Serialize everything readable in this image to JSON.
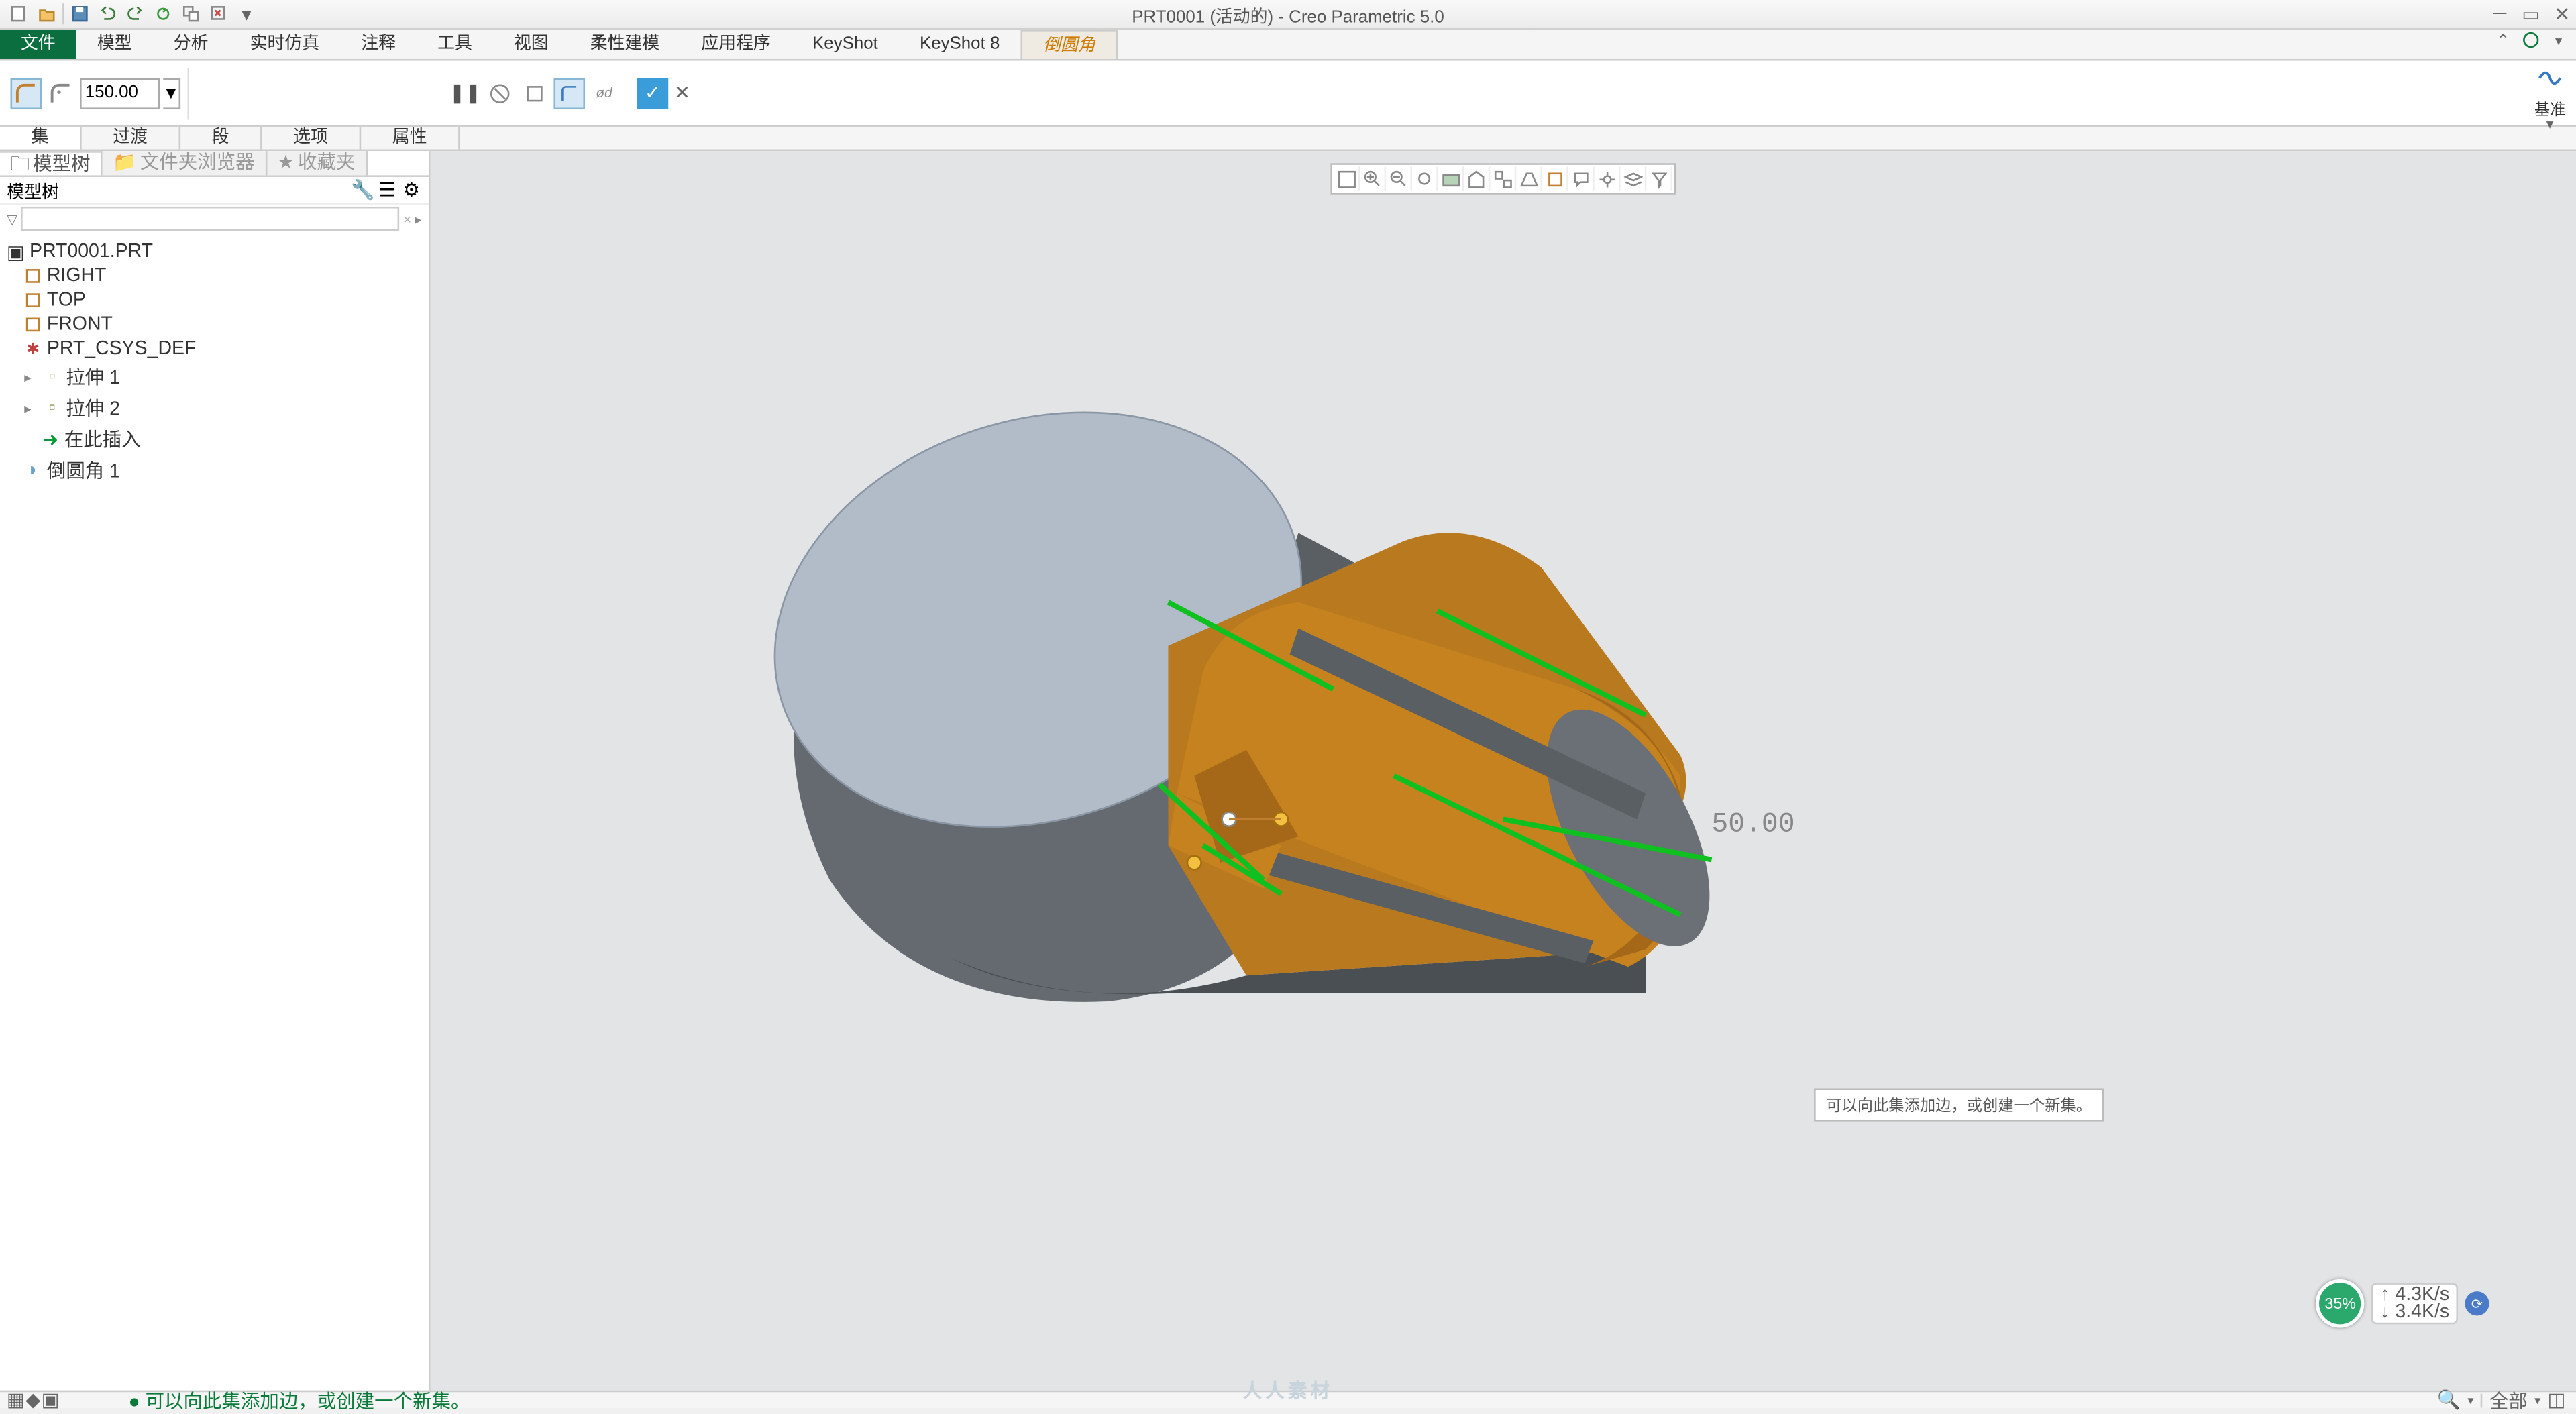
{
  "title": "PRT0001 (活动的) - Creo Parametric 5.0",
  "ribbon": {
    "file": "文件",
    "tabs": [
      "模型",
      "分析",
      "实时仿真",
      "注释",
      "工具",
      "视图",
      "柔性建模",
      "应用程序",
      "KeyShot",
      "KeyShot 8"
    ],
    "active_tab": "倒圆角",
    "right_group_label": "基准"
  },
  "dashboard": {
    "value": "150.00",
    "subtabs": [
      "集",
      "过渡",
      "段",
      "选项",
      "属性"
    ]
  },
  "left_panel": {
    "tabs": [
      "模型树",
      "文件夹浏览器",
      "收藏夹"
    ],
    "title": "模型树",
    "search_placeholder": "",
    "tree": {
      "root": "PRT0001.PRT",
      "items": [
        {
          "label": "RIGHT",
          "type": "datum"
        },
        {
          "label": "TOP",
          "type": "datum"
        },
        {
          "label": "FRONT",
          "type": "datum"
        },
        {
          "label": "PRT_CSYS_DEF",
          "type": "csys"
        },
        {
          "label": "拉伸 1",
          "type": "feat",
          "expandable": true
        },
        {
          "label": "拉伸 2",
          "type": "feat",
          "expandable": true
        },
        {
          "label": "在此插入",
          "type": "insert"
        },
        {
          "label": "倒圆角 1",
          "type": "round"
        }
      ]
    }
  },
  "viewport": {
    "hint": "可以向此集添加边，或创建一个新集。",
    "dimension": "50.00"
  },
  "perf": {
    "percent": "35%",
    "line1": "4.3K/s",
    "line2": "3.4K/s"
  },
  "status": {
    "message": "● 可以向此集添加边，或创建一个新集。",
    "filter": "全部"
  },
  "watermark": "人人素材"
}
